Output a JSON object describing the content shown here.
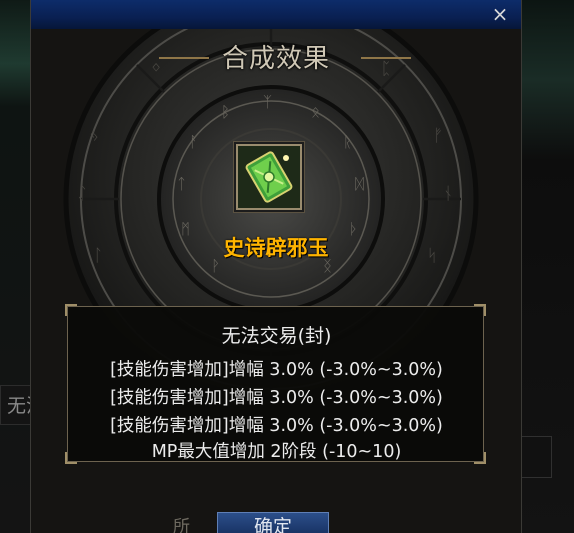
{
  "dialog": {
    "close_label": "×",
    "header_title": "合成效果",
    "item_name": "史诗辟邪玉",
    "item_icon": "jade-talisman-icon",
    "confirm_label": "确定"
  },
  "stats": {
    "title": "无法交易(封)",
    "lines": [
      "[技能伤害增加]增幅 3.0% (-3.0%~3.0%)",
      "[技能伤害增加]增幅 3.0% (-3.0%~3.0%)",
      "[技能伤害增加]增幅 3.0% (-3.0%~3.0%)",
      "MP最大值增加 2阶段 (-10~10)"
    ]
  },
  "background": {
    "left_field_text": "无法",
    "bottom_label": "所"
  },
  "colors": {
    "titlebar": "#0a2052",
    "item_name": "#ffb400",
    "panel_border": "#6d634f",
    "stat_text": "#ececec"
  }
}
